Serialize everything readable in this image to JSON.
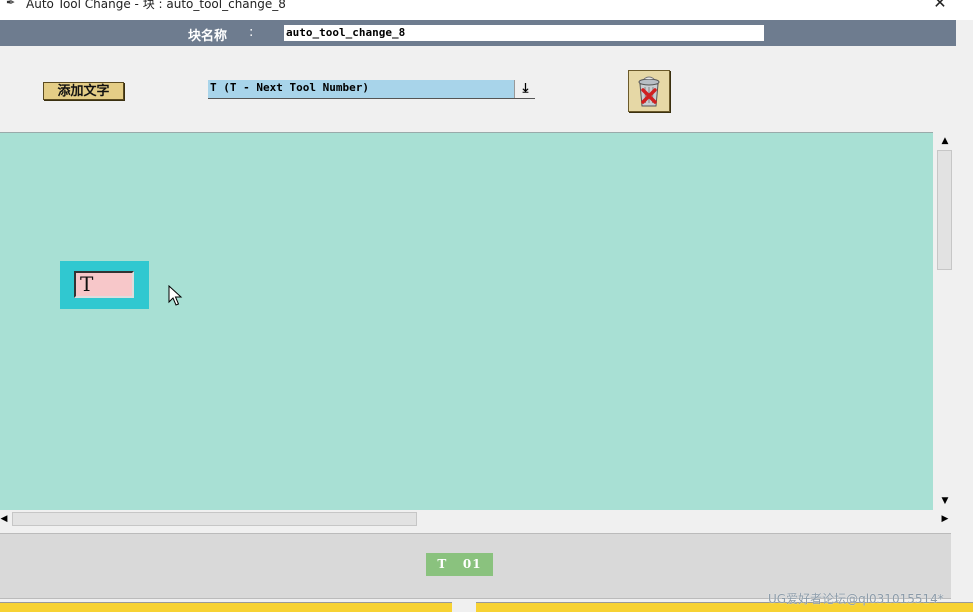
{
  "window": {
    "title": "Auto Tool Change  -  块 : auto_tool_change_8",
    "close_glyph": "✕"
  },
  "block_name": {
    "label": "块名称",
    "separator": ":",
    "value": "auto_tool_change_8"
  },
  "toolbar": {
    "add_text_label": "添加文字",
    "address_select": {
      "selected": "T (T - Next Tool Number)",
      "dropdown_glyph": "⤓"
    },
    "delete_icon": "trash-icon"
  },
  "canvas": {
    "background": "#a8e0d4",
    "element": {
      "value": "T",
      "tile_color": "#30c8d0",
      "input_color": "#f7c7c9"
    }
  },
  "scrollbars": {
    "up": "▲",
    "down": "▼",
    "left": "◀",
    "right": "▶"
  },
  "preview": {
    "badge_text": "T   01",
    "badge_color": "#8ac27e"
  },
  "watermark": "UG爱好者论坛@ql031015514*"
}
